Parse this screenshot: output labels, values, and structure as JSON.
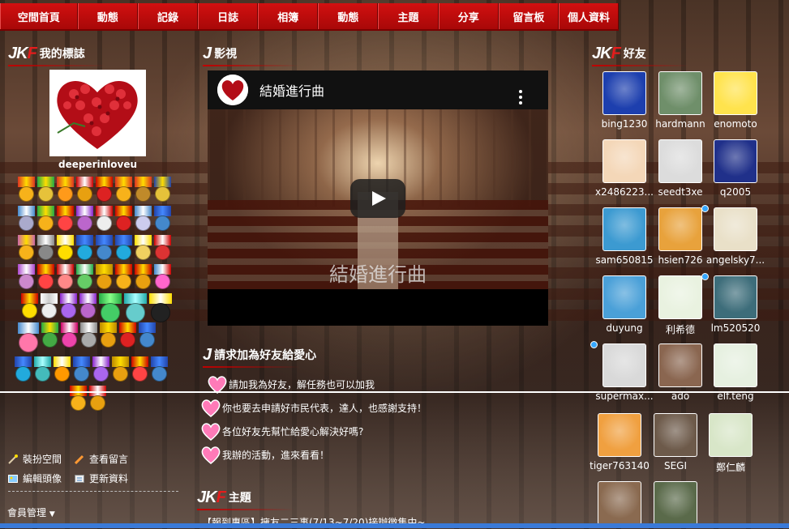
{
  "nav": {
    "items": [
      "空間首頁",
      "動態",
      "記錄",
      "日誌",
      "相簿",
      "動態",
      "主題",
      "分享",
      "留言板",
      "個人資料"
    ]
  },
  "logo": {
    "j": "JK",
    "f": "F"
  },
  "left": {
    "heading": "我的標誌",
    "username": "deeperinloveu",
    "links": {
      "decorate": "裝扮空間",
      "view_messages": "查看留言",
      "edit_avatar": "編輯頭像",
      "update_profile": "更新資料"
    },
    "member_manage": "會員管理"
  },
  "video_section": {
    "heading": "影視",
    "title": "結婚進行曲",
    "overlay": "結婚進行曲"
  },
  "love_section": {
    "heading": "請求加為好友給愛心",
    "items": [
      "請加我為好友，解任務也可以加我",
      "你也要去申請好市民代表，達人，也感謝支持！",
      "各位好友先幫忙給愛心解決好嗎?",
      "我辦的活動，進來看看！"
    ]
  },
  "topic_section": {
    "heading": "主題",
    "first_item": "【報到專區】擁友二三事(7/13~7/20)接辦徵集中~"
  },
  "friends_section": {
    "heading": "好友",
    "friends": [
      {
        "name": "bing1230",
        "color": "#1d3fae"
      },
      {
        "name": "hardmann",
        "color": "#6f8f6a"
      },
      {
        "name": "enomoto",
        "color": "#ffe34d"
      },
      {
        "name": "x2486223...",
        "color": "#f4d7b8"
      },
      {
        "name": "seedt3xe",
        "color": "#dcdcdc"
      },
      {
        "name": "q2005",
        "color": "#20308a"
      },
      {
        "name": "sam650815",
        "color": "#3c9ad1"
      },
      {
        "name": "hsien726",
        "color": "#e8a23c"
      },
      {
        "name": "angelsky7...",
        "color": "#e9e0c8"
      },
      {
        "name": "duyung",
        "color": "#4aa0d8"
      },
      {
        "name": "利希德",
        "color": "#e9f2e0"
      },
      {
        "name": "lm520520",
        "color": "#3d6d7a"
      },
      {
        "name": "supermax...",
        "color": "#d9d9d9"
      },
      {
        "name": "ado",
        "color": "#8a6650"
      },
      {
        "name": "elf.teng",
        "color": "#e6f0e0"
      },
      {
        "name": "tiger763140",
        "color": "#f0a040"
      },
      {
        "name": "SEGI",
        "color": "#6d5a4a"
      },
      {
        "name": "鄭仁麟",
        "color": "#d8e6c8"
      },
      {
        "name": "",
        "color": "#8a6a50"
      },
      {
        "name": "",
        "color": "#5a6a4a"
      }
    ]
  }
}
